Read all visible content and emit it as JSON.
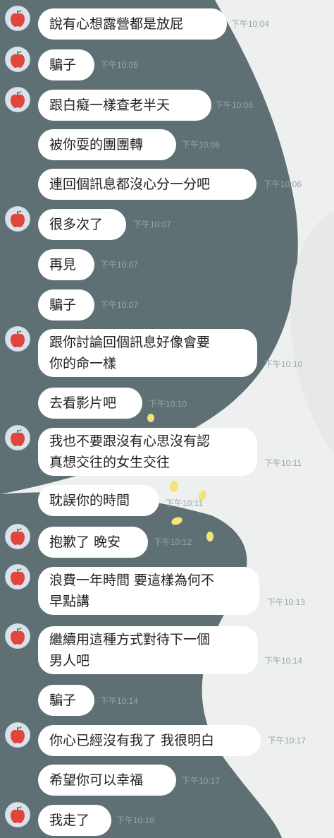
{
  "colors": {
    "background_dark": "#5f7074",
    "background_light": "#eef0ef",
    "bubble": "#ffffff",
    "avatar": "#d9e3ee",
    "apple": "#e0463b"
  },
  "messages": [
    {
      "text": "說有心想露營都是放屁",
      "time": "下午10:04",
      "avatar": true
    },
    {
      "text": "騙子",
      "time": "下午10:05",
      "avatar": true
    },
    {
      "text": "跟白癡一樣查老半天",
      "time": "下午10:06",
      "avatar": true
    },
    {
      "text": "被你耍的團團轉",
      "time": "下午10:06",
      "avatar": false
    },
    {
      "text": "連回個訊息都沒心分一分吧",
      "time": "下午10:06",
      "avatar": false
    },
    {
      "text": "很多次了",
      "time": "下午10:07",
      "avatar": true
    },
    {
      "text": "再見",
      "time": "下午10:07",
      "avatar": false
    },
    {
      "text": "騙子",
      "time": "下午10:07",
      "avatar": false
    },
    {
      "text": "跟你討論回個訊息好像會要\n你的命一樣",
      "time": "下午10:10",
      "avatar": true
    },
    {
      "text": "去看影片吧",
      "time": "下午10:10",
      "avatar": false
    },
    {
      "text": "我也不要跟沒有心思沒有認\n真想交往的女生交往",
      "time": "下午10:11",
      "avatar": true
    },
    {
      "text": "耽誤你的時間",
      "time": "下午10:11",
      "avatar": false
    },
    {
      "text": "抱歉了 晚安",
      "time": "下午10:12",
      "avatar": true
    },
    {
      "text": "浪費一年時間 要這樣為何不\n早點講",
      "time": "下午10:13",
      "avatar": true
    },
    {
      "text": "繼續用這種方式對待下一個\n男人吧",
      "time": "下午10:14",
      "avatar": true
    },
    {
      "text": "騙子",
      "time": "下午10:14",
      "avatar": false
    },
    {
      "text": "你心已經沒有我了 我很明白",
      "time": "下午10:17",
      "avatar": true
    },
    {
      "text": "希望你可以幸福",
      "time": "下午10:17",
      "avatar": false
    },
    {
      "text": "我走了",
      "time": "下午10:18",
      "avatar": true
    }
  ]
}
